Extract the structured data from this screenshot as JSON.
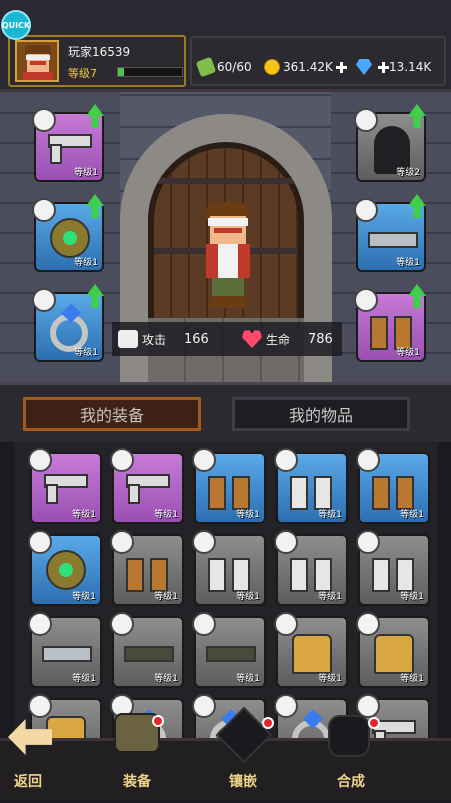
{
  "quick_label": "QUICK",
  "player": {
    "name": "玩家16539",
    "level": "等级7",
    "xp_progress": 0.1
  },
  "resources": {
    "energy": "60/60",
    "coins": "361.42K",
    "gems": "13.14K"
  },
  "stats": {
    "attack_label": "攻击",
    "attack_value": "166",
    "hp_label": "生命",
    "hp_value": "786"
  },
  "equipped": {
    "left": [
      {
        "item": "pistol",
        "rarity": "purple",
        "level": "等级1",
        "upgrade": true
      },
      {
        "item": "amulet",
        "rarity": "blue",
        "level": "等级1",
        "upgrade": true
      },
      {
        "item": "ring",
        "rarity": "blue",
        "level": "等级1",
        "upgrade": true
      }
    ],
    "right": [
      {
        "item": "cloak",
        "rarity": "gray",
        "level": "等级2",
        "upgrade": true
      },
      {
        "item": "belt",
        "rarity": "blue",
        "level": "等级1",
        "upgrade": true
      },
      {
        "item": "boots",
        "rarity": "purple",
        "level": "等级1",
        "upgrade": true
      }
    ]
  },
  "tabs": {
    "equipment": "我的装备",
    "items": "我的物品"
  },
  "inventory": [
    [
      {
        "item": "pistol",
        "rarity": "purple",
        "level": "等级1"
      },
      {
        "item": "pistol",
        "rarity": "purple",
        "level": "等级1"
      },
      {
        "item": "boots-brown",
        "rarity": "blue",
        "level": "等级1"
      },
      {
        "item": "boots-white",
        "rarity": "blue",
        "level": "等级1"
      },
      {
        "item": "boots-brown",
        "rarity": "blue",
        "level": "等级1"
      }
    ],
    [
      {
        "item": "amulet",
        "rarity": "blue",
        "level": "等级1"
      },
      {
        "item": "boots-brown",
        "rarity": "gray",
        "level": "等级1"
      },
      {
        "item": "boots-white",
        "rarity": "gray",
        "level": "等级1"
      },
      {
        "item": "boots-white",
        "rarity": "gray",
        "level": "等级1"
      },
      {
        "item": "boots-white",
        "rarity": "gray",
        "level": "等级1"
      }
    ],
    [
      {
        "item": "belt",
        "rarity": "gray",
        "level": "等级1"
      },
      {
        "item": "belt-dark",
        "rarity": "gray",
        "level": "等级1"
      },
      {
        "item": "belt-dark",
        "rarity": "gray",
        "level": "等级1"
      },
      {
        "item": "armor",
        "rarity": "gray",
        "level": "等级1"
      },
      {
        "item": "armor",
        "rarity": "gray",
        "level": "等级1"
      }
    ],
    [
      {
        "item": "armor",
        "rarity": "gray",
        "level": ""
      },
      {
        "item": "ring",
        "rarity": "gray",
        "level": ""
      },
      {
        "item": "ring",
        "rarity": "gray",
        "level": ""
      },
      {
        "item": "ring",
        "rarity": "gray",
        "level": ""
      },
      {
        "item": "pistol",
        "rarity": "gray",
        "level": ""
      }
    ]
  ],
  "nav": {
    "back": "返回",
    "equip": "装备",
    "socket": "镶嵌",
    "forge": "合成"
  },
  "colors": {
    "purple": "#b065c8",
    "blue": "#3f87cc",
    "gray": "#747474",
    "upgrade": "#3fcf4a",
    "gold_border": "#a07a1e"
  }
}
